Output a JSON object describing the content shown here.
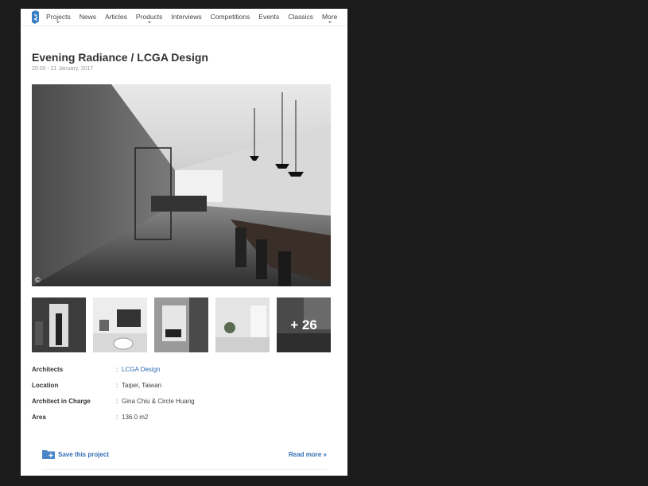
{
  "nav": {
    "items": [
      {
        "label": "Projects",
        "dropdown": true
      },
      {
        "label": "News",
        "dropdown": false
      },
      {
        "label": "Articles",
        "dropdown": false
      },
      {
        "label": "Products",
        "dropdown": true
      },
      {
        "label": "Interviews",
        "dropdown": false
      },
      {
        "label": "Competitions",
        "dropdown": false
      },
      {
        "label": "Events",
        "dropdown": false
      },
      {
        "label": "Classics",
        "dropdown": false
      },
      {
        "label": "More",
        "dropdown": true
      }
    ]
  },
  "article": {
    "title": "Evening Radiance / LCGA Design",
    "date": "20:00 - 21 January, 2017",
    "copyright": "©"
  },
  "gallery": {
    "more_label": "+ 26"
  },
  "specs": [
    {
      "label": "Architects",
      "value": "LCGA Design",
      "link": true
    },
    {
      "label": "Location",
      "value": "Taipei, Taiwan",
      "link": false
    },
    {
      "label": "Architect in Charge",
      "value": "Gina Chiu & Circle Huang",
      "link": false
    },
    {
      "label": "Area",
      "value": "136.0 m2",
      "link": false
    }
  ],
  "spec_separator": ":",
  "actions": {
    "save_label": "Save this project",
    "read_more_label": "Read more »"
  },
  "colors": {
    "link": "#2f6db5",
    "logo": "#3b7fc4"
  },
  "icons": {
    "logo": "archdaily-logo-icon",
    "save": "folder-add-icon"
  }
}
